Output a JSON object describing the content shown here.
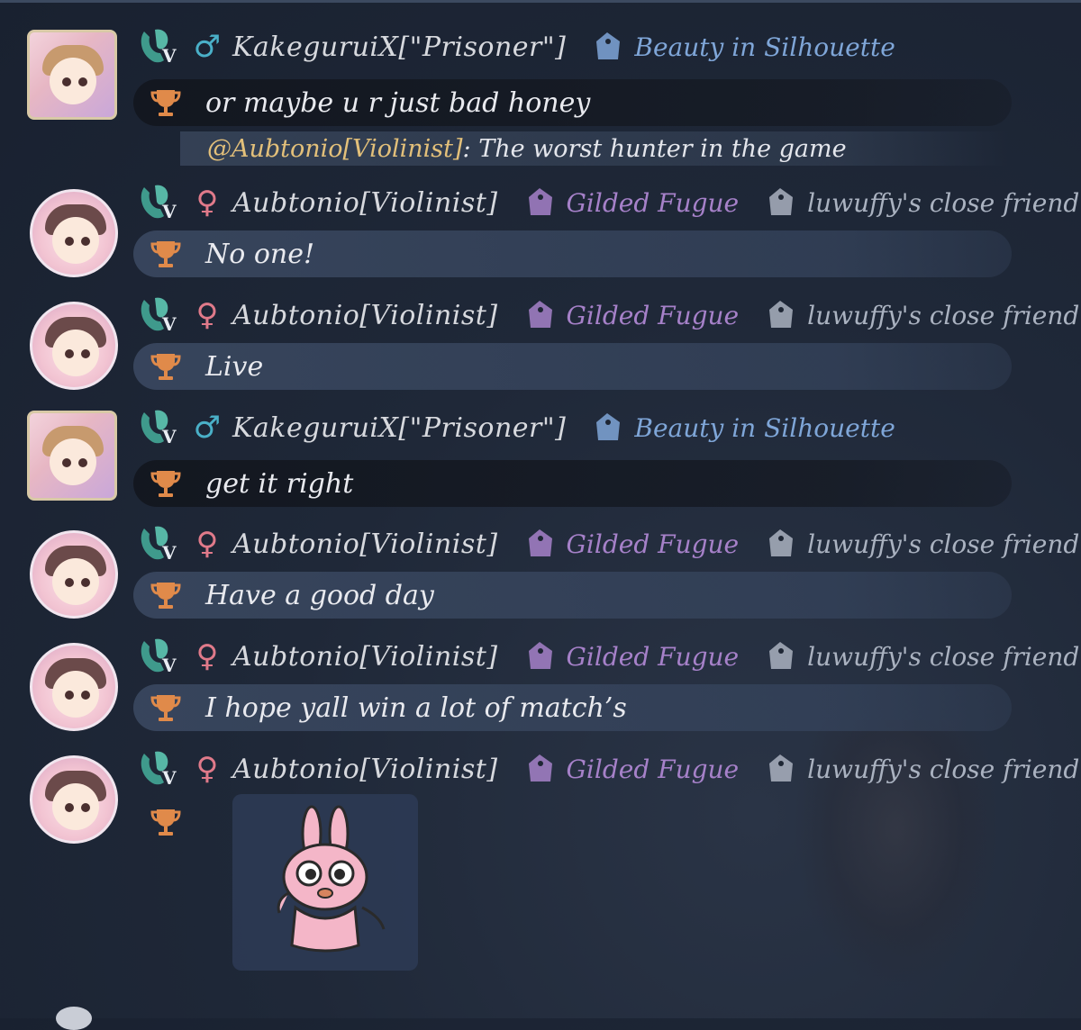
{
  "messages": [
    {
      "name": "KakeguruiX[\"Prisoner\"]",
      "gender": "♂",
      "gender_class": "m",
      "avatar": "framed",
      "tags": [
        {
          "label": "Beauty in Silhouette",
          "color": "blue"
        }
      ],
      "bubble_style": "dark",
      "text": "or maybe u r just bad honey",
      "reply": {
        "mention": "@Aubtonio[Violinist]",
        "text": ": The worst hunter in the game"
      }
    },
    {
      "name": "Aubtonio[Violinist]",
      "gender": "♀",
      "gender_class": "f",
      "avatar": "round",
      "tags": [
        {
          "label": "Gilded Fugue",
          "color": "purple"
        },
        {
          "label": "luwuffy's close friend",
          "color": "grey"
        }
      ],
      "bubble_style": "light",
      "text": "No one!"
    },
    {
      "name": "Aubtonio[Violinist]",
      "gender": "♀",
      "gender_class": "f",
      "avatar": "round",
      "tags": [
        {
          "label": "Gilded Fugue",
          "color": "purple"
        },
        {
          "label": "luwuffy's close friend",
          "color": "grey"
        }
      ],
      "bubble_style": "light",
      "text": "Live"
    },
    {
      "name": "KakeguruiX[\"Prisoner\"]",
      "gender": "♂",
      "gender_class": "m",
      "avatar": "framed",
      "tags": [
        {
          "label": "Beauty in Silhouette",
          "color": "blue"
        }
      ],
      "bubble_style": "dark",
      "text": "get it right"
    },
    {
      "name": "Aubtonio[Violinist]",
      "gender": "♀",
      "gender_class": "f",
      "avatar": "round",
      "tags": [
        {
          "label": "Gilded Fugue",
          "color": "purple"
        },
        {
          "label": "luwuffy's close friend",
          "color": "grey"
        }
      ],
      "bubble_style": "light",
      "text": "Have a good day"
    },
    {
      "name": "Aubtonio[Violinist]",
      "gender": "♀",
      "gender_class": "f",
      "avatar": "round",
      "tags": [
        {
          "label": "Gilded Fugue",
          "color": "purple"
        },
        {
          "label": "luwuffy's close friend",
          "color": "grey"
        }
      ],
      "bubble_style": "light",
      "text": "I hope yall win a lot of match’s"
    },
    {
      "name": "Aubtonio[Violinist]",
      "gender": "♀",
      "gender_class": "f",
      "avatar": "round",
      "tags": [
        {
          "label": "Gilded Fugue",
          "color": "purple"
        },
        {
          "label": "luwuffy's close friend",
          "color": "grey"
        }
      ],
      "bubble_style": "sticker",
      "text": "",
      "sticker": "pink-bunny-sticker"
    }
  ],
  "colors": {
    "tag_blue": "#7fa6d8",
    "tag_purple": "#a681c9",
    "tag_grey": "#aab2c0",
    "mention": "#e3c07a",
    "gender_male": "#4ab0c8",
    "gender_female": "#e07a8a",
    "trophy": "#e08a4a"
  },
  "icons": {
    "badge": "v-rank-badge-icon",
    "trophy": "trophy-icon",
    "tag": "tag-icon"
  }
}
